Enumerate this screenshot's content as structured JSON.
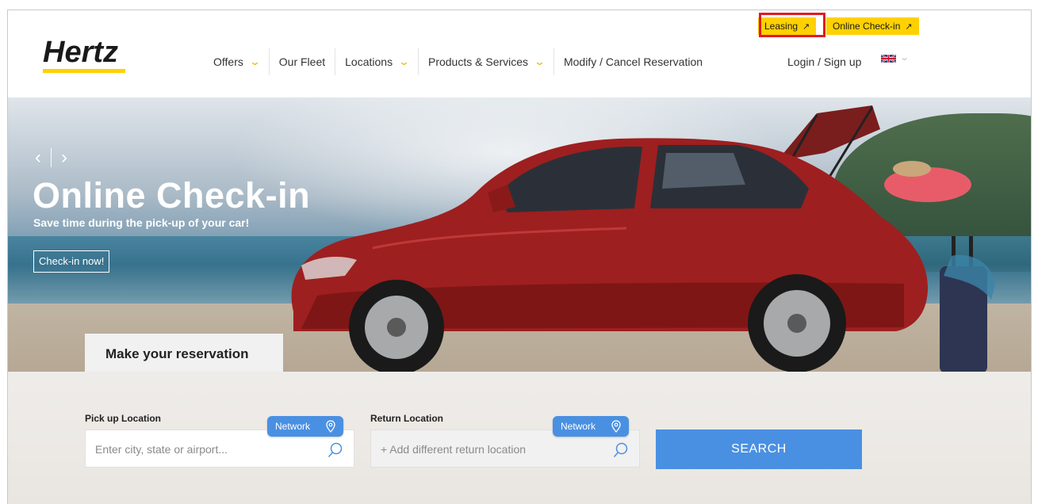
{
  "header": {
    "logo_text": "Hertz",
    "top_links": [
      {
        "label": "Leasing",
        "arrow": "↗"
      },
      {
        "label": "Online Check-in",
        "arrow": "↗"
      }
    ],
    "nav": [
      {
        "label": "Offers",
        "dropdown": true
      },
      {
        "label": "Our Fleet",
        "dropdown": false
      },
      {
        "label": "Locations",
        "dropdown": true
      },
      {
        "label": "Products & Services",
        "dropdown": true
      },
      {
        "label": "Modify / Cancel Reservation",
        "dropdown": false
      }
    ],
    "login": "Login / Sign up",
    "language_icon": "uk-flag-icon"
  },
  "hero": {
    "title": "Online Check-in",
    "subtitle": "Save time during the pick-up of your car!",
    "cta": "Check-in now!"
  },
  "reservation": {
    "tab_label": "Make your reservation",
    "pickup": {
      "label": "Pick up Location",
      "placeholder": "Enter city, state or airport...",
      "network": "Network"
    },
    "return": {
      "label": "Return Location",
      "placeholder": "+ Add different return location",
      "network": "Network"
    },
    "search_label": "SEARCH"
  },
  "colors": {
    "brand_yellow": "#ffd100",
    "accent_blue": "#4a90e2",
    "highlight_red": "#e01b24"
  }
}
